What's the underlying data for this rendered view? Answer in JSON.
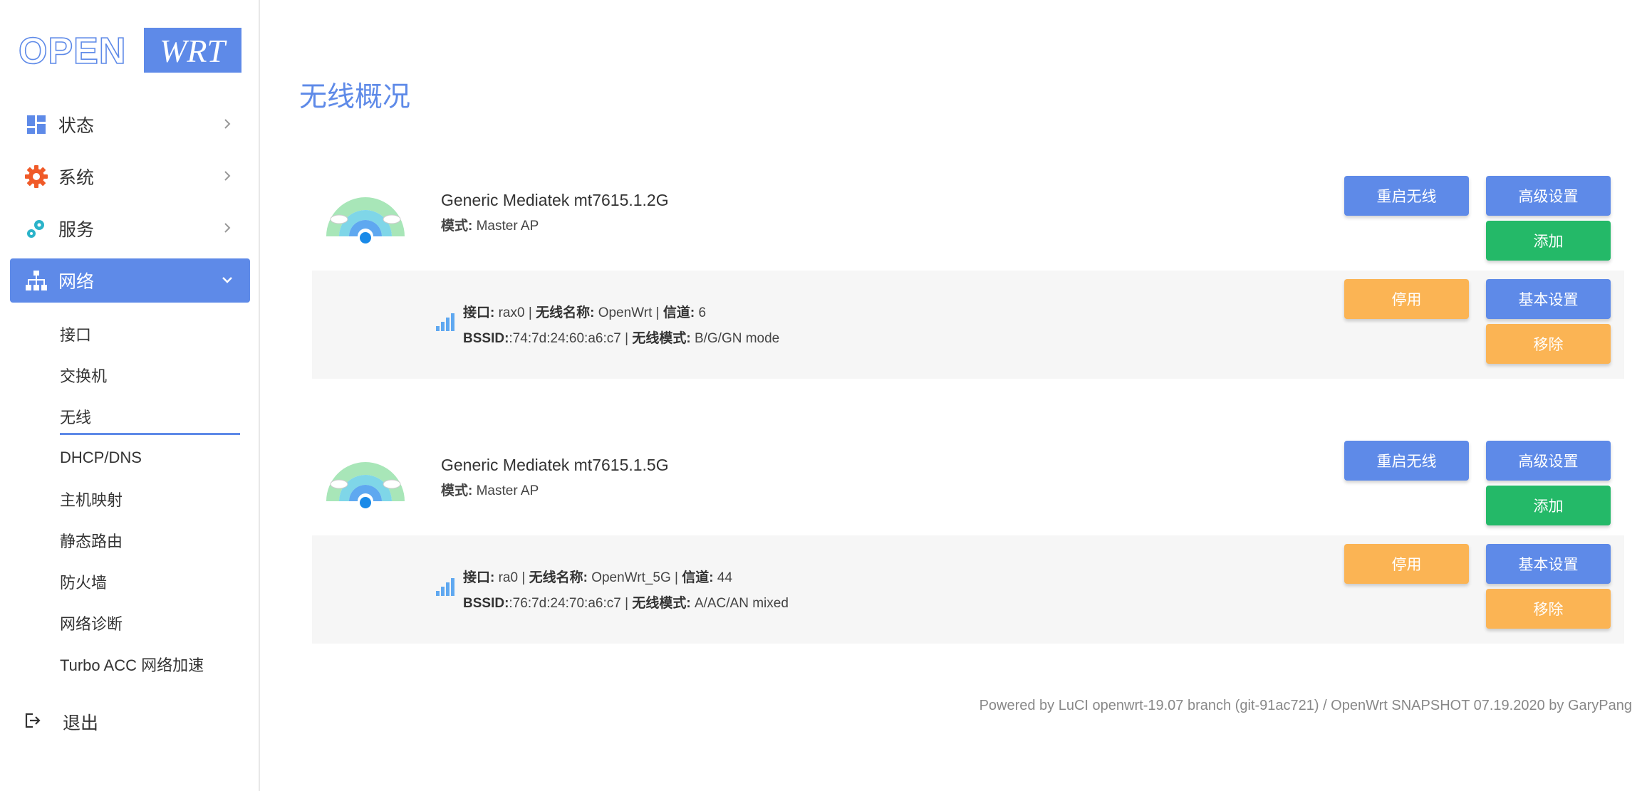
{
  "logo": {
    "left_text": "OPEN",
    "right_text": "WRT"
  },
  "sidebar": {
    "menu": [
      {
        "label": "状态",
        "icon": "dashboard-icon"
      },
      {
        "label": "系统",
        "icon": "gear-icon"
      },
      {
        "label": "服务",
        "icon": "cogs-icon"
      },
      {
        "label": "网络",
        "icon": "sitemap-icon"
      }
    ],
    "submenu": [
      "接口",
      "交换机",
      "无线",
      "DHCP/DNS",
      "主机映射",
      "静态路由",
      "防火墙",
      "网络诊断",
      "Turbo ACC 网络加速"
    ],
    "logout": "退出"
  },
  "page": {
    "title": "无线概况"
  },
  "radios": [
    {
      "name": "Generic Mediatek mt7615.1.2G",
      "mode_label": "模式:",
      "mode_value": "Master AP",
      "restart_btn": "重启无线",
      "advanced_btn": "高级设置",
      "add_btn": "添加",
      "network": {
        "iface_label": "接口:",
        "iface_value": "rax0",
        "ssid_label": "无线名称:",
        "ssid_value": "OpenWrt",
        "channel_label": "信道:",
        "channel_value": "6",
        "bssid_label": "BSSID:",
        "bssid_value": ":74:7d:24:60:a6:c7",
        "wmode_label": "无线模式:",
        "wmode_value": "B/G/GN mode",
        "disable_btn": "停用",
        "basic_btn": "基本设置",
        "remove_btn": "移除"
      }
    },
    {
      "name": "Generic Mediatek mt7615.1.5G",
      "mode_label": "模式:",
      "mode_value": "Master AP",
      "restart_btn": "重启无线",
      "advanced_btn": "高级设置",
      "add_btn": "添加",
      "network": {
        "iface_label": "接口:",
        "iface_value": "ra0",
        "ssid_label": "无线名称:",
        "ssid_value": "OpenWrt_5G",
        "channel_label": "信道:",
        "channel_value": "44",
        "bssid_label": "BSSID:",
        "bssid_value": ":76:7d:24:70:a6:c7",
        "wmode_label": "无线模式:",
        "wmode_value": "A/AC/AN mixed",
        "disable_btn": "停用",
        "basic_btn": "基本设置",
        "remove_btn": "移除"
      }
    }
  ],
  "footer": {
    "text": "Powered by LuCI openwrt-19.07 branch (git-91ac721) / OpenWrt SNAPSHOT 07.19.2020 by GaryPang"
  },
  "colors": {
    "accent": "#5e8ae8",
    "green": "#24b968",
    "orange": "#fbb454",
    "row_bg": "#f6f6f6"
  }
}
